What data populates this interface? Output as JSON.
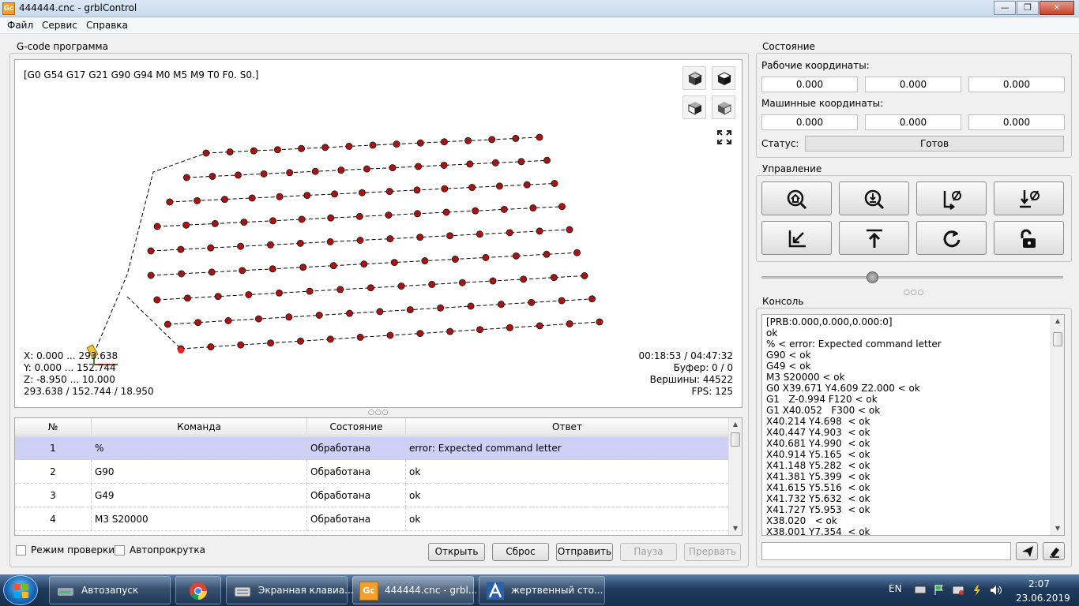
{
  "window": {
    "title": "444444.cnc - grblControl",
    "app_icon": "Gc"
  },
  "menu": [
    "Файл",
    "Сервис",
    "Справка"
  ],
  "gcode": {
    "group_title": "G-code программа",
    "modal_state": "[G0 G54 G17 G21 G90 G94 M0 M5 M9 T0 F0. S0.]",
    "info_left": [
      "X: 0.000 ... 293.638",
      "Y: 0.000 ... 152.744",
      "Z: -8.950 ... 10.000",
      "293.638 / 152.744 / 18.950"
    ],
    "info_right": [
      "00:18:53 / 04:47:32",
      "Буфер: 0 / 0",
      "Вершины: 44522",
      "FPS: 125"
    ]
  },
  "table": {
    "headers": [
      "№",
      "Команда",
      "Состояние",
      "Ответ"
    ],
    "rows": [
      {
        "n": "1",
        "cmd": "%",
        "state": "Обработана",
        "resp": "error: Expected command letter"
      },
      {
        "n": "2",
        "cmd": "G90",
        "state": "Обработана",
        "resp": "ok"
      },
      {
        "n": "3",
        "cmd": "G49",
        "state": "Обработана",
        "resp": "ok"
      },
      {
        "n": "4",
        "cmd": "M3 S20000",
        "state": "Обработана",
        "resp": "ok"
      }
    ]
  },
  "bottom": {
    "check_mode": "Режим проверки",
    "autoscroll": "Автопрокрутка",
    "open": "Открыть",
    "reset": "Сброс",
    "send": "Отправить",
    "pause": "Пауза",
    "abort": "Прервать"
  },
  "state": {
    "group_title": "Состояние",
    "work_label": "Рабочие координаты:",
    "work": [
      "0.000",
      "0.000",
      "0.000"
    ],
    "machine_label": "Машинные координаты:",
    "machine": [
      "0.000",
      "0.000",
      "0.000"
    ],
    "status_label": "Статус:",
    "status_value": "Готов"
  },
  "control": {
    "group_title": "Управление",
    "slider_fraction": 0.37
  },
  "console": {
    "group_title": "Консоль",
    "lines": [
      "[PRB:0.000,0.000,0.000:0]",
      "ok",
      "% < error: Expected command letter",
      "G90 < ok",
      "G49 < ok",
      "M3 S20000 < ok",
      "G0 X39.671 Y4.609 Z2.000 < ok",
      "G1   Z-0.994 F120 < ok",
      "G1 X40.052   F300 < ok",
      "X40.214 Y4.698  < ok",
      "X40.447 Y4.903  < ok",
      "X40.681 Y4.990  < ok",
      "X40.914 Y5.165  < ok",
      "X41.148 Y5.282  < ok",
      "X41.381 Y5.399  < ok",
      "X41.615 Y5.516  < ok",
      "X41.732 Y5.632  < ok",
      "X41.727 Y5.953  < ok",
      "X38.020   < ok",
      "X38.001 Y7.354  < ok"
    ]
  },
  "taskbar": {
    "tasks": [
      "Автозапуск",
      "",
      "Экранная клавиа...",
      "444444.cnc - grbl...",
      "жертвенный сто..."
    ],
    "lang": "EN",
    "time": "2:07",
    "date": "23.06.2019"
  }
}
